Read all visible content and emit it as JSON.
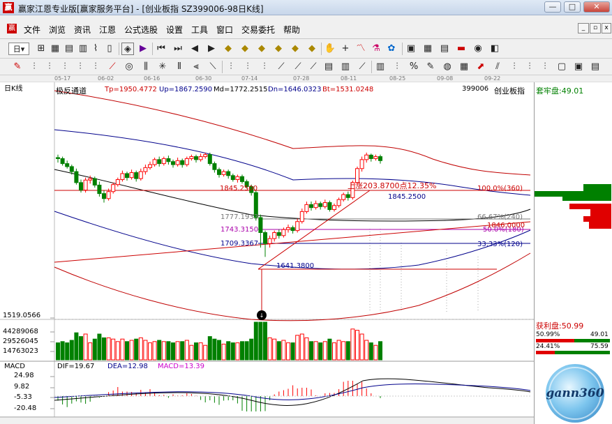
{
  "window": {
    "title": "赢家江恩专业版[赢家服务平台] - [创业板指 SZ399006-98日K线]",
    "logo_char": "赢",
    "btn_min": "—",
    "btn_max": "□",
    "btn_close": "✕"
  },
  "menu": [
    "文件",
    "浏览",
    "资讯",
    "江恩",
    "公式选股",
    "设置",
    "工具",
    "窗口",
    "交易委托",
    "帮助"
  ],
  "menu_logo": "赢",
  "dates": [
    "05-17",
    "06-02",
    "06-16",
    "06-30",
    "07-14",
    "07-28",
    "08-11",
    "08-25",
    "09-08",
    "09-22"
  ],
  "chart_header": {
    "period": "日K线",
    "indicator": "极反通道",
    "tp": "Tp=1950.4772",
    "up": "Up=1867.2590",
    "md": "Md=1772.2515",
    "dn": "Dn=1646.0323",
    "bt": "Bt=1531.0248",
    "code": "399006",
    "name": "创业板指"
  },
  "annotations": {
    "high_price": "1845.2500",
    "high_price2": "1845.2500",
    "rise": "上涨203.8700点12.35%",
    "fib100": "100.0%(360)",
    "fib66": "66.67%(240)",
    "fib50": "50.0%(180)",
    "fib33": "33.33%(120)",
    "fib_mid": "1846.0000",
    "lv1777": "1777.1933",
    "lv1743": "1743.3150",
    "lv1709": "1709.3367",
    "low_price": "1641.3800"
  },
  "price_axis": {
    "low_label": "1519.0566"
  },
  "volume_axis": [
    "44289068",
    "29526045",
    "14763023"
  ],
  "macd": {
    "label": "MACD",
    "dif": "DIF=19.67",
    "dea": "DEA=12.98",
    "macd": "MACD=13.39",
    "ticks": [
      "24.98",
      "9.82",
      "-5.33",
      "-20.48"
    ]
  },
  "right_panel": {
    "trap": "套牢盘:49.01",
    "profit": "获利盘:50.99",
    "r1a": "50.99%",
    "r1b": "49.01",
    "r2a": "24.41%",
    "r2b": "75.59",
    "logo": "gann360"
  },
  "colors": {
    "up": "#ff0000",
    "down": "#008000",
    "bg": "#ffffff",
    "channel": "#c00000",
    "channel2": "#00008b"
  },
  "chart_data": {
    "type": "candlestick",
    "title": "创业板指 399006 日K线",
    "indicator": "极反通道",
    "series": [
      {
        "name": "Tp",
        "value": 1950.4772
      },
      {
        "name": "Up",
        "value": 1867.259
      },
      {
        "name": "Md",
        "value": 1772.2515
      },
      {
        "name": "Dn",
        "value": 1646.0323
      },
      {
        "name": "Bt",
        "value": 1531.0248
      }
    ],
    "candles": [
      [
        1840,
        1838,
        1846,
        1830
      ],
      [
        1838,
        1828,
        1842,
        1824
      ],
      [
        1828,
        1822,
        1834,
        1818
      ],
      [
        1822,
        1812,
        1826,
        1806
      ],
      [
        1812,
        1790,
        1818,
        1786
      ],
      [
        1790,
        1775,
        1796,
        1770
      ],
      [
        1775,
        1795,
        1800,
        1770
      ],
      [
        1795,
        1798,
        1804,
        1788
      ],
      [
        1798,
        1785,
        1802,
        1780
      ],
      [
        1785,
        1768,
        1792,
        1762
      ],
      [
        1768,
        1758,
        1774,
        1750
      ],
      [
        1758,
        1772,
        1778,
        1754
      ],
      [
        1772,
        1786,
        1790,
        1768
      ],
      [
        1786,
        1796,
        1800,
        1782
      ],
      [
        1796,
        1808,
        1814,
        1792
      ],
      [
        1808,
        1800,
        1812,
        1794
      ],
      [
        1800,
        1810,
        1816,
        1796
      ],
      [
        1810,
        1798,
        1814,
        1792
      ],
      [
        1798,
        1812,
        1818,
        1794
      ],
      [
        1812,
        1820,
        1826,
        1806
      ],
      [
        1820,
        1826,
        1832,
        1816
      ],
      [
        1826,
        1836,
        1840,
        1822
      ],
      [
        1836,
        1828,
        1842,
        1822
      ],
      [
        1828,
        1838,
        1842,
        1824
      ],
      [
        1838,
        1832,
        1844,
        1826
      ],
      [
        1832,
        1826,
        1836,
        1820
      ],
      [
        1826,
        1834,
        1840,
        1822
      ],
      [
        1834,
        1826,
        1838,
        1820
      ],
      [
        1826,
        1838,
        1842,
        1822
      ],
      [
        1838,
        1842,
        1846,
        1834
      ],
      [
        1842,
        1836,
        1846,
        1830
      ],
      [
        1836,
        1842,
        1848,
        1832
      ],
      [
        1842,
        1846,
        1850,
        1838
      ],
      [
        1846,
        1828,
        1850,
        1824
      ],
      [
        1828,
        1816,
        1832,
        1810
      ],
      [
        1816,
        1806,
        1820,
        1800
      ],
      [
        1806,
        1812,
        1816,
        1802
      ],
      [
        1812,
        1804,
        1816,
        1798
      ],
      [
        1804,
        1796,
        1808,
        1792
      ],
      [
        1796,
        1802,
        1806,
        1790
      ],
      [
        1802,
        1792,
        1806,
        1788
      ],
      [
        1792,
        1782,
        1796,
        1778
      ],
      [
        1782,
        1770,
        1786,
        1764
      ],
      [
        1770,
        1720,
        1774,
        1714
      ],
      [
        1720,
        1690,
        1726,
        1660
      ],
      [
        1690,
        1668,
        1694,
        1641.38
      ],
      [
        1668,
        1678,
        1684,
        1660
      ],
      [
        1678,
        1690,
        1694,
        1672
      ],
      [
        1690,
        1684,
        1696,
        1678
      ],
      [
        1684,
        1696,
        1700,
        1680
      ],
      [
        1696,
        1700,
        1706,
        1690
      ],
      [
        1700,
        1694,
        1704,
        1688
      ],
      [
        1694,
        1712,
        1718,
        1690
      ],
      [
        1712,
        1732,
        1738,
        1708
      ],
      [
        1732,
        1746,
        1752,
        1728
      ],
      [
        1746,
        1740,
        1752,
        1734
      ],
      [
        1740,
        1748,
        1754,
        1736
      ],
      [
        1748,
        1742,
        1752,
        1736
      ],
      [
        1742,
        1750,
        1756,
        1738
      ],
      [
        1750,
        1736,
        1754,
        1732
      ],
      [
        1736,
        1744,
        1748,
        1732
      ],
      [
        1744,
        1756,
        1760,
        1740
      ],
      [
        1756,
        1766,
        1770,
        1752
      ],
      [
        1766,
        1760,
        1772,
        1754
      ],
      [
        1760,
        1790,
        1794,
        1756
      ],
      [
        1790,
        1818,
        1822,
        1786
      ],
      [
        1818,
        1836,
        1842,
        1812
      ],
      [
        1836,
        1845.25,
        1850,
        1830
      ],
      [
        1845,
        1838,
        1848,
        1832
      ],
      [
        1838,
        1842,
        1846,
        1834
      ],
      [
        1842,
        1834,
        1846,
        1828
      ]
    ],
    "ylim": [
      1519.0566,
      1960
    ],
    "volume_ticks": [
      44289068,
      29526045,
      14763023
    ],
    "macd_ticks": [
      24.98,
      9.82,
      -5.33,
      -20.48
    ],
    "fib_levels": [
      {
        "label": "100.0%(360)",
        "value": 1845.25
      },
      {
        "label": "66.67%(240)",
        "value": 1777.1933
      },
      {
        "label": "50.0%(180)",
        "value": 1743.315
      },
      {
        "label": "33.33%(120)",
        "value": 1709.3367
      }
    ]
  }
}
